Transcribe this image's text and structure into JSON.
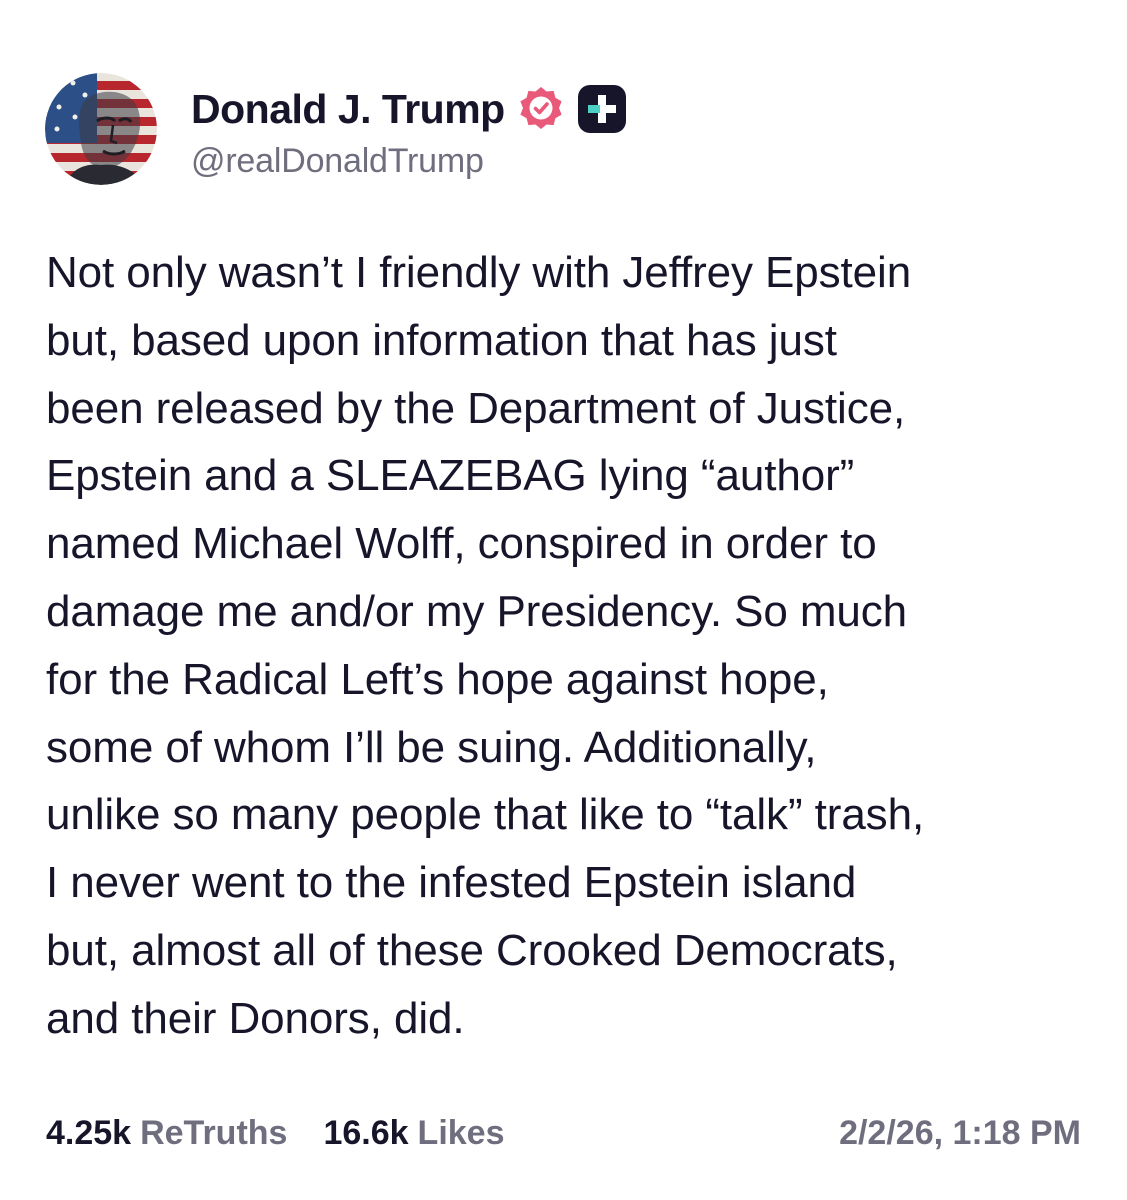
{
  "author": {
    "display_name": "Donald J. Trump",
    "handle": "@realDonaldTrump",
    "avatar_icon": "flag-portrait-avatar",
    "verified_icon": "verified-badge-icon",
    "plus_icon": "truth-plus-badge-icon"
  },
  "post": {
    "text": "Not only wasn’t I friendly with Jeffrey Epstein\nbut, based upon information that has just\nbeen released by the Department of Justice,\nEpstein and a SLEAZEBAG lying “author”\nnamed Michael Wolff, conspired in order to\ndamage me and/or my Presidency. So much\nfor the Radical Left’s hope against hope,\nsome of whom I’ll be suing. Additionally,\nunlike so many people that like to “talk” trash,\nI never went to the infested Epstein island\nbut, almost all of these Crooked Democrats,\nand their Donors, did."
  },
  "stats": {
    "retruths_count": "4.25k",
    "retruths_label": "ReTruths",
    "likes_count": "16.6k",
    "likes_label": "Likes",
    "timestamp": "2/2/26, 1:18 PM"
  },
  "colors": {
    "text_primary": "#16152a",
    "text_secondary": "#6f6e7e",
    "verified_pink": "#e8597a",
    "badge_dark": "#16152a",
    "badge_accent": "#4dd0c4"
  }
}
